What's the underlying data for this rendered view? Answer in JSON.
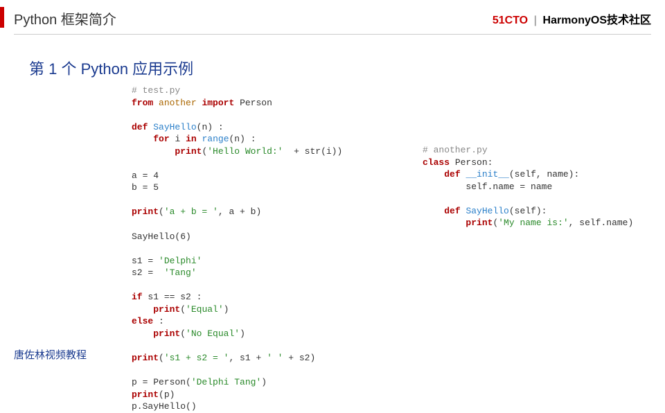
{
  "header": {
    "left_title": "Python 框架简介",
    "brand_51cto": "51CTO",
    "brand_sep": "|",
    "brand_harmony": "HarmonyOS技术社区"
  },
  "section_title": "第 1 个 Python 应用示例",
  "code_left": {
    "comment_test": "# test.py",
    "kw_from": "from",
    "mod_another": "another",
    "kw_import": "import",
    "cls_person": "Person",
    "kw_def": "def",
    "fn_sayhello": "SayHello",
    "param_n": "(n) :",
    "kw_for": "for",
    "var_i": "i",
    "kw_in": "in",
    "fn_range": "range",
    "range_tail": "(n) :",
    "kw_print": "print",
    "str_hello": "'Hello World:'",
    "plus_str": "  + str(i))",
    "assign_a": "a = 4",
    "assign_b": "b = 5",
    "print_ab_str": "'a + b = '",
    "print_ab_expr": ", a + b)",
    "call_sayhello": "SayHello(6)",
    "s1_assign": "s1 = ",
    "s1_val": "'Delphi'",
    "s2_assign": "s2 =  ",
    "s2_val": "'Tang'",
    "kw_if": "if",
    "if_cond": " s1 == s2 :",
    "str_equal": "'Equal'",
    "kw_else": "else",
    "else_tail": " :",
    "str_noequal": "'No Equal'",
    "print_s12_str": "'s1 + s2 = '",
    "print_s12_expr": ", s1 + ",
    "str_space": "' '",
    "print_s12_tail": " + s2)",
    "p_assign": "p = Person(",
    "p_arg": "'Delphi Tang'",
    "p_close": ")",
    "print_p": "(p)",
    "p_sayhello": "p.SayHello()"
  },
  "code_right": {
    "comment_another": "# another.py",
    "kw_class": "class",
    "cls_person": " Person:",
    "kw_def": "def",
    "dunder_init": "__init__",
    "init_params": "(self, name):",
    "self_name": "self.name = name",
    "fn_sayhello": "SayHello",
    "sayhello_params": "(self):",
    "kw_print": "print",
    "str_myname": "'My name is:'",
    "print_tail": ", self.name)"
  },
  "footer": "唐佐林视频教程"
}
